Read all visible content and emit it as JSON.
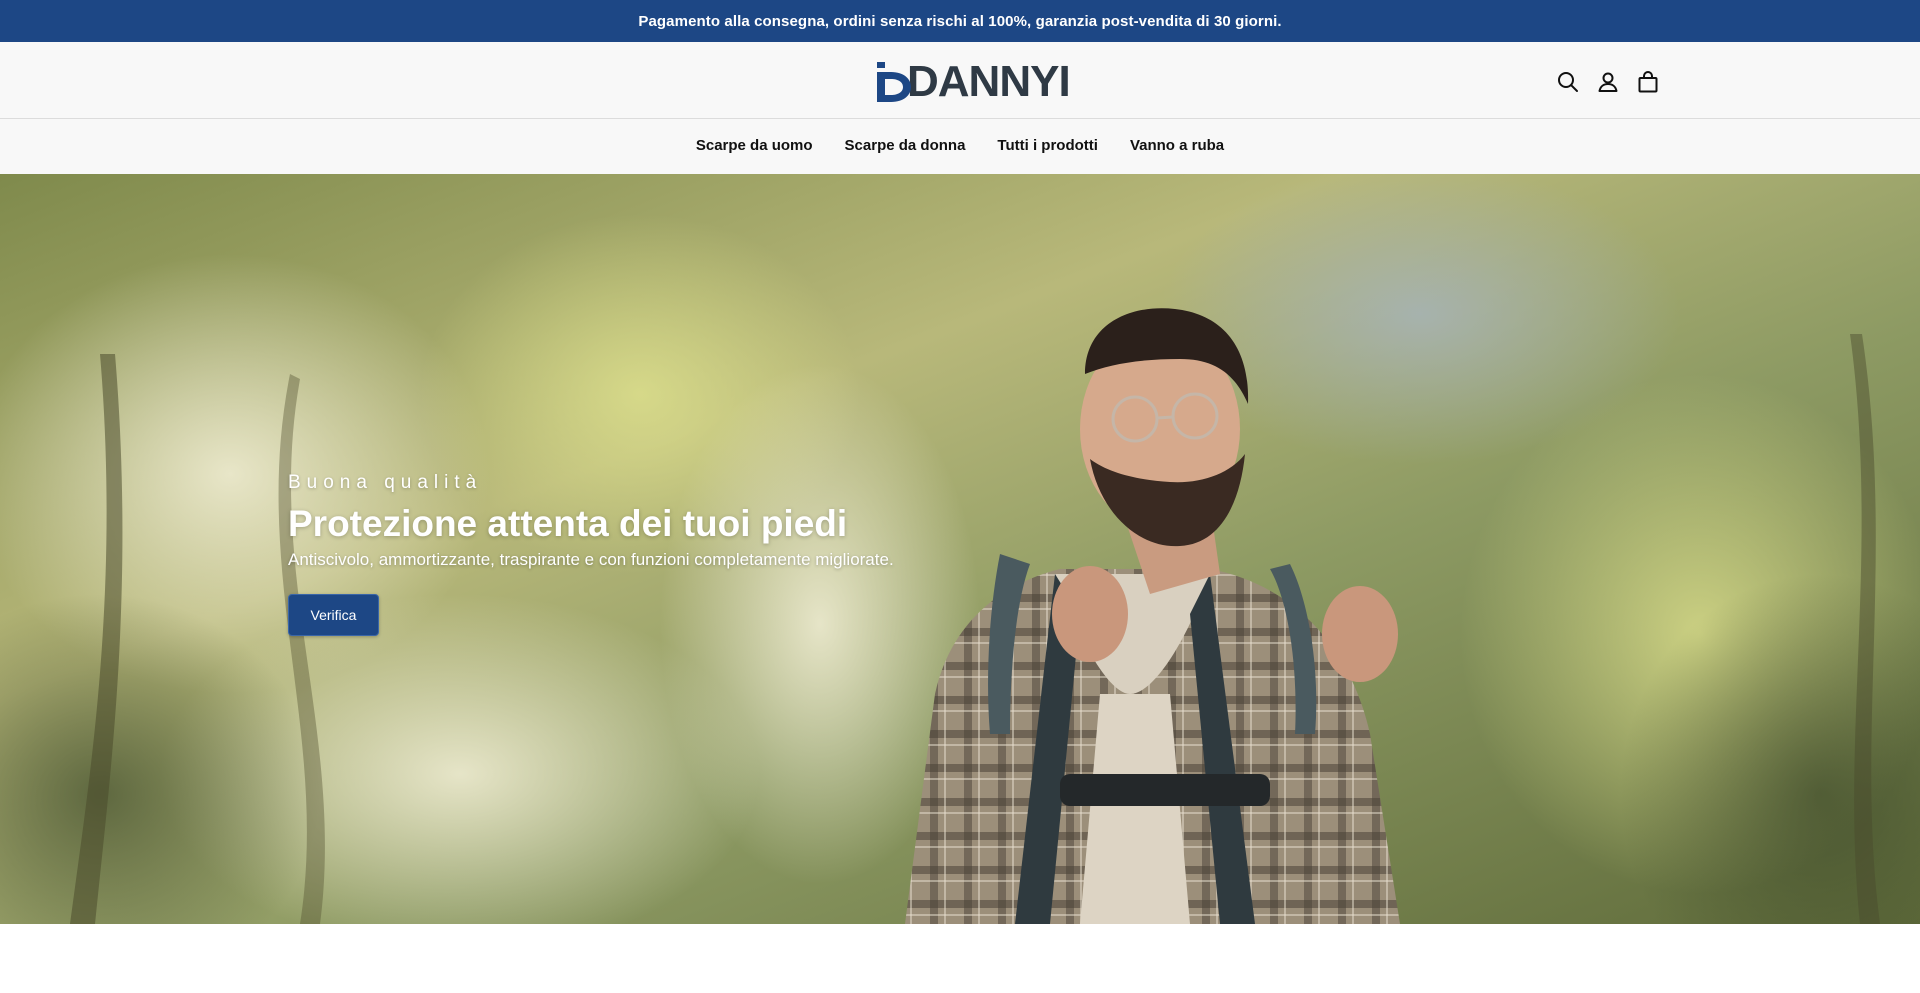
{
  "announcement": {
    "text": "Pagamento alla consegna, ordini senza rischi al 100%, garanzia post-vendita di 30 giorni.",
    "background": "#1d4785"
  },
  "header": {
    "logo_text": "DANNYI",
    "logo_colors": {
      "mark": "#1d4785",
      "text": "#2f3a45"
    },
    "icons": [
      "search-icon",
      "account-icon",
      "cart-icon"
    ]
  },
  "nav": {
    "items": [
      {
        "label": "Scarpe da uomo"
      },
      {
        "label": "Scarpe da donna"
      },
      {
        "label": "Tutti i prodotti"
      },
      {
        "label": "Vanno a ruba"
      }
    ]
  },
  "hero": {
    "eyebrow": "Buona qualità",
    "title": "Protezione attenta dei tuoi piedi",
    "subtitle": "Antiscivolo, ammortizzante, traspirante e con funzioni completamente migliorate.",
    "button_label": "Verifica",
    "accent": "#1d4785"
  }
}
